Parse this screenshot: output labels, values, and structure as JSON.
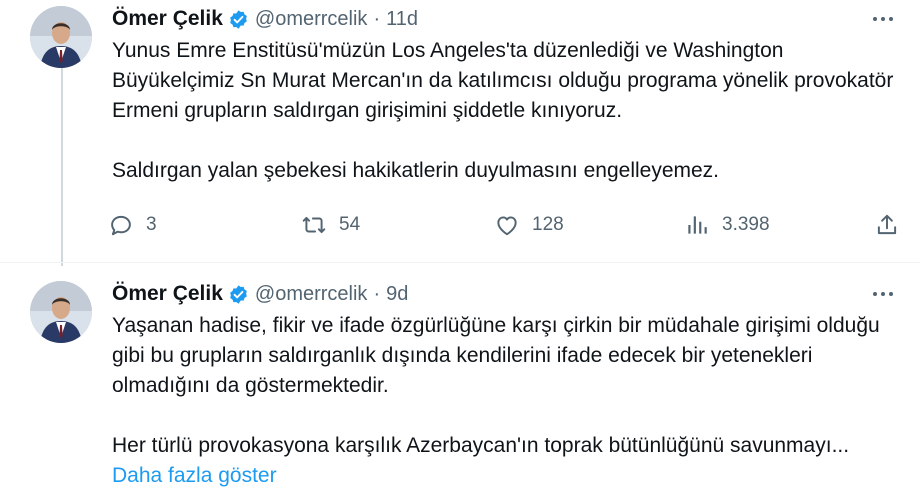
{
  "tweets": [
    {
      "author": "Ömer Çelik",
      "handle": "@omerrcelik",
      "separator": "·",
      "time": "11d",
      "paragraphs": [
        "Yunus Emre Enstitüsü'müzün Los Angeles'ta düzenlediği ve Washington Büyükelçimiz Sn Murat Mercan'ın da katılımcısı olduğu programa yönelik provokatör Ermeni grupların saldırgan girişimini şiddetle kınıyoruz.",
        "Saldırgan yalan şebekesi hakikatlerin duyulmasını engelleyemez."
      ],
      "actions": {
        "replies": "3",
        "retweets": "54",
        "likes": "128",
        "views": "3.398"
      }
    },
    {
      "author": "Ömer Çelik",
      "handle": "@omerrcelik",
      "separator": "·",
      "time": "9d",
      "paragraphs": [
        "Yaşanan hadise, fikir ve ifade özgürlüğüne karşı çirkin bir müdahale girişimi olduğu gibi bu grupların saldırganlık dışında kendilerini ifade edecek bir yetenekleri olmadığını da göstermektedir.",
        "Her türlü provokasyona karşılık Azerbaycan'ın toprak bütünlüğünü savunmayı..."
      ],
      "show_more": "Daha fazla göster"
    }
  ],
  "icons": [
    "reply-icon",
    "retweet-icon",
    "like-icon",
    "views-icon",
    "share-icon",
    "more-icon",
    "verified-badge-icon"
  ],
  "colors": {
    "accent": "#1d9bf0",
    "text": "#0f1419",
    "muted": "#536471",
    "border": "#eff3f4"
  }
}
